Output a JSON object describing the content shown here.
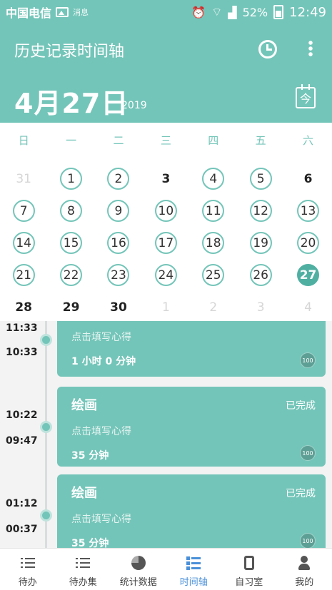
{
  "status_bar": {
    "carrier": "中国电信",
    "extra": "消息",
    "battery": "52%",
    "time": "12:49"
  },
  "header": {
    "title": "历史记录时间轴",
    "date": "4月27日",
    "year": "2019",
    "today_icon_text": "今"
  },
  "calendar": {
    "weekdays": [
      "日",
      "一",
      "二",
      "三",
      "四",
      "五",
      "六"
    ],
    "rows": [
      [
        {
          "d": "31",
          "s": "other"
        },
        {
          "d": "1",
          "s": "circle"
        },
        {
          "d": "2",
          "s": "circle"
        },
        {
          "d": "3",
          "s": "plain"
        },
        {
          "d": "4",
          "s": "circle"
        },
        {
          "d": "5",
          "s": "circle"
        },
        {
          "d": "6",
          "s": "plain"
        }
      ],
      [
        {
          "d": "7",
          "s": "circle"
        },
        {
          "d": "8",
          "s": "circle"
        },
        {
          "d": "9",
          "s": "circle"
        },
        {
          "d": "10",
          "s": "circle"
        },
        {
          "d": "11",
          "s": "circle"
        },
        {
          "d": "12",
          "s": "circle"
        },
        {
          "d": "13",
          "s": "circle"
        }
      ],
      [
        {
          "d": "14",
          "s": "circle"
        },
        {
          "d": "15",
          "s": "circle"
        },
        {
          "d": "16",
          "s": "circle"
        },
        {
          "d": "17",
          "s": "circle"
        },
        {
          "d": "18",
          "s": "circle"
        },
        {
          "d": "19",
          "s": "circle"
        },
        {
          "d": "20",
          "s": "circle"
        }
      ],
      [
        {
          "d": "21",
          "s": "circle"
        },
        {
          "d": "22",
          "s": "circle"
        },
        {
          "d": "23",
          "s": "circle"
        },
        {
          "d": "24",
          "s": "circle"
        },
        {
          "d": "25",
          "s": "circle"
        },
        {
          "d": "26",
          "s": "circle"
        },
        {
          "d": "27",
          "s": "selected"
        }
      ],
      [
        {
          "d": "28",
          "s": "plain"
        },
        {
          "d": "29",
          "s": "plain"
        },
        {
          "d": "30",
          "s": "plain"
        },
        {
          "d": "1",
          "s": "other"
        },
        {
          "d": "2",
          "s": "other"
        },
        {
          "d": "3",
          "s": "other"
        },
        {
          "d": "4",
          "s": "other"
        }
      ]
    ]
  },
  "timeline": {
    "entries": [
      {
        "end": "11:33",
        "start": "10:33",
        "title": "",
        "status": "",
        "note": "点击填写心得",
        "duration": "1 小时 0 分钟",
        "badge": "100"
      },
      {
        "end": "10:22",
        "start": "09:47",
        "title": "绘画",
        "status": "已完成",
        "note": "点击填写心得",
        "duration": "35 分钟",
        "badge": "100"
      },
      {
        "end": "01:12",
        "start": "00:37",
        "title": "绘画",
        "status": "已完成",
        "note": "点击填写心得",
        "duration": "35 分钟",
        "badge": "100"
      }
    ]
  },
  "bottom_nav": [
    {
      "label": "待办",
      "icon": "list-icon",
      "active": false
    },
    {
      "label": "待办集",
      "icon": "list-icon",
      "active": false
    },
    {
      "label": "统计数据",
      "icon": "pie-chart-icon",
      "active": false
    },
    {
      "label": "时间轴",
      "icon": "timeline-icon",
      "active": true
    },
    {
      "label": "自习室",
      "icon": "study-room-icon",
      "active": false
    },
    {
      "label": "我的",
      "icon": "user-icon",
      "active": false
    }
  ],
  "colors": {
    "primary": "#74c5b9",
    "selected": "#4fb0a2",
    "nav_active": "#4a90d9"
  }
}
